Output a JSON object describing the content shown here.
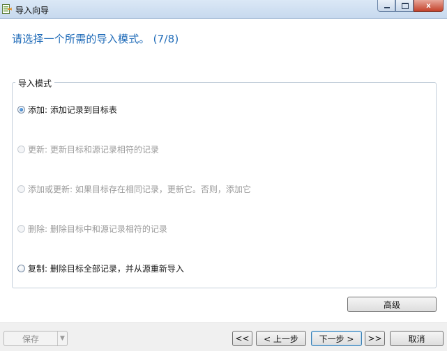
{
  "window": {
    "title": "导入向导",
    "close_glyph": "x",
    "minimize_icon": "minimize-icon",
    "maximize_icon": "maximize-icon",
    "app_icon": "import-wizard-icon"
  },
  "wizard": {
    "heading": "请选择一个所需的导入模式。 (7/8)"
  },
  "import_mode": {
    "group_title": "导入模式",
    "options": [
      {
        "label": "添加: 添加记录到目标表",
        "checked": true,
        "enabled": true
      },
      {
        "label": "更新: 更新目标和源记录相符的记录",
        "checked": false,
        "enabled": false
      },
      {
        "label": "添加或更新: 如果目标存在相同记录，更新它。否则，添加它",
        "checked": false,
        "enabled": false
      },
      {
        "label": "删除: 删除目标中和源记录相符的记录",
        "checked": false,
        "enabled": false
      },
      {
        "label": "复制: 删除目标全部记录，并从源重新导入",
        "checked": false,
        "enabled": true
      }
    ],
    "advanced_label": "高级"
  },
  "footer": {
    "save_label": "保存",
    "save_dropdown_icon": "triangle-down-icon",
    "first_label": "<<",
    "prev_label": "< 上一步",
    "next_label": "下一步 >",
    "last_label": ">>",
    "cancel_label": "取消"
  },
  "colors": {
    "heading": "#1f6bb8",
    "titlebar": "#c7d9ee",
    "disabled_text": "#9b9b9b"
  }
}
